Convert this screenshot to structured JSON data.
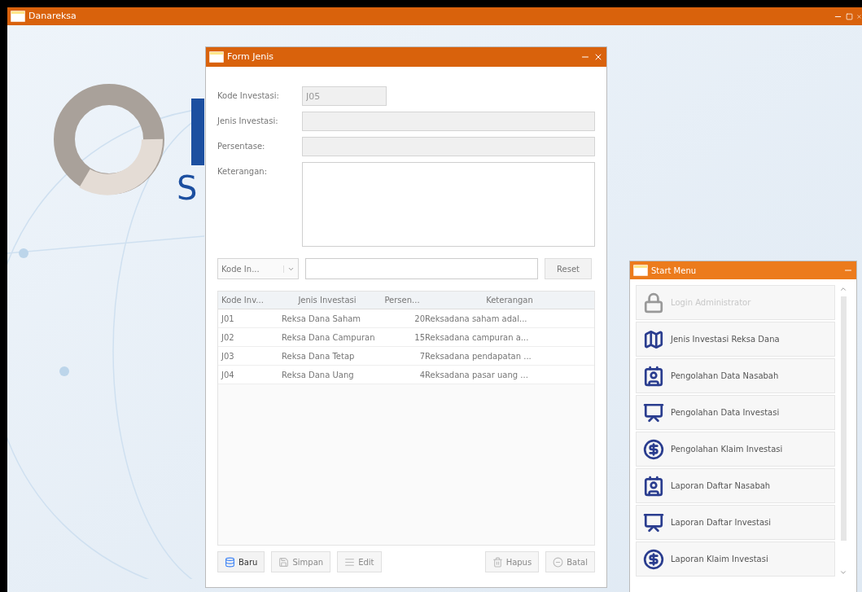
{
  "main_window": {
    "title": "Danareksa"
  },
  "logo": {
    "letter": "S"
  },
  "form_window": {
    "title": "Form Jenis",
    "fields": [
      {
        "label": "Kode Investasi:",
        "value": "J05",
        "disabled": true,
        "kind": "input"
      },
      {
        "label": "Jenis Investasi:",
        "disabled": true,
        "kind": "input"
      },
      {
        "label": "Persentase:",
        "disabled": true,
        "kind": "input"
      },
      {
        "label": "Keterangan:",
        "disabled": false,
        "kind": "textarea"
      }
    ],
    "search": {
      "filter": "Kode In...",
      "reset": "Reset"
    },
    "table": {
      "columns": [
        "Kode Inv...",
        "Jenis Investasi",
        "Persen...",
        "Keterangan"
      ],
      "rows": [
        [
          "J01",
          "Reksa Dana Saham",
          "20",
          "Reksadana saham adal..."
        ],
        [
          "J02",
          "Reksa Dana Campuran",
          "15",
          "Reksadana campuran a..."
        ],
        [
          "J03",
          "Reksa Dana Tetap",
          "7",
          "Reksadana pendapatan ..."
        ],
        [
          "J04",
          "Reksa Dana Uang",
          "4",
          "Reksadana pasar uang ..."
        ]
      ]
    },
    "buttons": [
      {
        "label": "Baru",
        "disabled": false,
        "kind": "new"
      },
      {
        "label": "Simpan",
        "disabled": true,
        "kind": "save"
      },
      {
        "label": "Edit",
        "disabled": true,
        "kind": "edit"
      },
      {
        "label": "Hapus",
        "disabled": true,
        "kind": "delete"
      },
      {
        "label": "Batal",
        "disabled": true,
        "kind": "cancel"
      }
    ]
  },
  "start_menu": {
    "title": "Start Menu",
    "items": [
      {
        "label": "Login Administrator",
        "disabled": true,
        "kind": "lock"
      },
      {
        "label": "Jenis Investasi Reksa Dana",
        "disabled": false,
        "kind": "map"
      },
      {
        "label": "Pengolahan Data Nasabah",
        "disabled": false,
        "kind": "card"
      },
      {
        "label": "Pengolahan Data Investasi",
        "disabled": false,
        "kind": "chart"
      },
      {
        "label": "Pengolahan Klaim Investasi",
        "disabled": false,
        "kind": "dollar"
      },
      {
        "label": "Laporan Daftar Nasabah",
        "disabled": false,
        "kind": "card"
      },
      {
        "label": "Laporan Daftar Investasi",
        "disabled": false,
        "kind": "chart"
      },
      {
        "label": "Laporan Klaim Investasi",
        "disabled": false,
        "kind": "dollar"
      }
    ]
  }
}
